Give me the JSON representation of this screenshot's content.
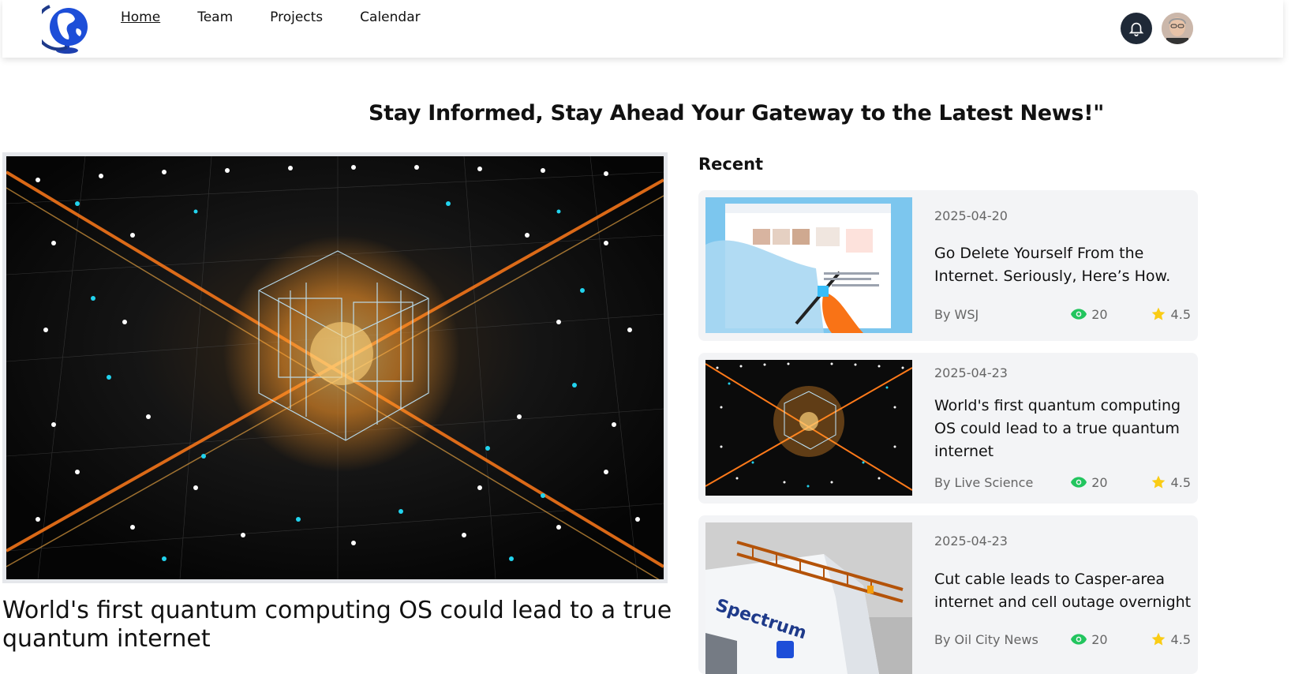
{
  "nav": {
    "links": [
      "Home",
      "Team",
      "Projects",
      "Calendar"
    ]
  },
  "headline": "Stay Informed, Stay Ahead Your Gateway to the Latest News!\"",
  "hero": {
    "title": "World's first quantum computing OS could lead to a true quantum internet"
  },
  "recent": {
    "label": "Recent",
    "items": [
      {
        "date": "2025-04-20",
        "title": "Go Delete Yourself From the Internet. Seriously, Here’s How.",
        "author": "By WSJ",
        "views": "20",
        "rating": "4.5"
      },
      {
        "date": "2025-04-23",
        "title": "World's first quantum computing OS could lead to a true quantum internet",
        "author": "By Live Science",
        "views": "20",
        "rating": "4.5"
      },
      {
        "date": "2025-04-23",
        "title": "Cut cable leads to Casper-area internet and cell outage overnight",
        "author": "By Oil City News",
        "views": "20",
        "rating": "4.5"
      }
    ]
  },
  "thumb_text": {
    "brand": "Spectrum"
  },
  "colors": {
    "accent_green": "#22c55e",
    "star_yellow": "#facc15",
    "card_bg": "#f3f4f6",
    "bell_bg": "#1f2937"
  }
}
